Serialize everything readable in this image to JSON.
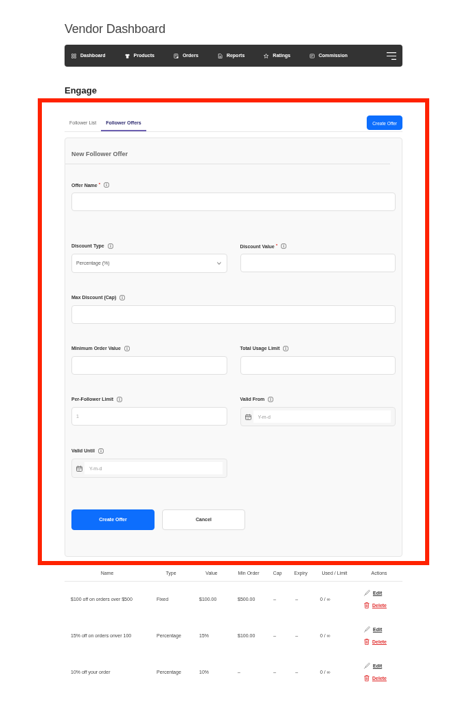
{
  "page": {
    "title": "Vendor Dashboard"
  },
  "navbar": {
    "items": [
      {
        "label": "Dashboard"
      },
      {
        "label": "Products"
      },
      {
        "label": "Orders"
      },
      {
        "label": "Reports"
      },
      {
        "label": "Ratings"
      },
      {
        "label": "Commission"
      }
    ]
  },
  "section": {
    "title": "Engage"
  },
  "panel": {
    "highlighted": true,
    "tabs": [
      {
        "label": "Follower List",
        "selected": false
      },
      {
        "label": "Follower Offers",
        "selected": true
      }
    ],
    "create_button": {
      "label": "Create Offer"
    },
    "form": {
      "title": "New Follower Offer",
      "rows": [
        {
          "kind": "wide",
          "fields": [
            {
              "kind": "text",
              "label": "Offer Name",
              "required_mark": "*"
            }
          ]
        },
        {
          "kind": "split",
          "fields": [
            {
              "kind": "select",
              "label": "Discount Type",
              "value": "Percentage (%)"
            },
            {
              "kind": "text",
              "label": "Discount Value",
              "required_mark": "*"
            }
          ]
        },
        {
          "kind": "wide",
          "fields": [
            {
              "kind": "text",
              "label": "Max Discount (Cap)"
            }
          ]
        },
        {
          "kind": "split",
          "fields": [
            {
              "kind": "text",
              "label": "Minimum Order Value"
            },
            {
              "kind": "text",
              "label": "Total Usage Limit"
            }
          ]
        },
        {
          "kind": "split",
          "fields": [
            {
              "kind": "text",
              "label": "Per-Follower Limit",
              "placeholder": "1"
            },
            {
              "kind": "date",
              "label": "Valid From",
              "placeholder": "Y-m-d"
            }
          ]
        },
        {
          "kind": "split",
          "fields": [
            {
              "kind": "date",
              "label": "Valid Until",
              "placeholder": "Y-m-d"
            }
          ]
        }
      ],
      "buttons": [
        {
          "kind": "primary",
          "label": "Create Offer"
        },
        {
          "kind": "secondary",
          "label": "Cancel"
        }
      ]
    }
  },
  "table": {
    "columns": [
      "Name",
      "Type",
      "Value",
      "Min Order",
      "Cap",
      "Expiry",
      "Used / Limit",
      "Actions"
    ],
    "rows": [
      {
        "cells": [
          "$100 off on orders over $500",
          "Fixed",
          "$100.00",
          "$500.00",
          "–",
          "–",
          "0 / ∞"
        ],
        "actions": [
          {
            "kind": "edit",
            "label": "Edit"
          },
          {
            "kind": "delete",
            "label": "Delete"
          }
        ]
      },
      {
        "cells": [
          "15% off on orders onver 100",
          "Percentage",
          "15%",
          "$100.00",
          "–",
          "–",
          "0 / ∞"
        ],
        "actions": [
          {
            "kind": "edit",
            "label": "Edit"
          },
          {
            "kind": "delete",
            "label": "Delete"
          }
        ]
      },
      {
        "cells": [
          "10% off your order",
          "Percentage",
          "10%",
          "–",
          "–",
          "–",
          "0 / ∞"
        ],
        "actions": [
          {
            "kind": "edit",
            "label": "Edit"
          },
          {
            "kind": "delete",
            "label": "Delete"
          }
        ]
      }
    ]
  }
}
